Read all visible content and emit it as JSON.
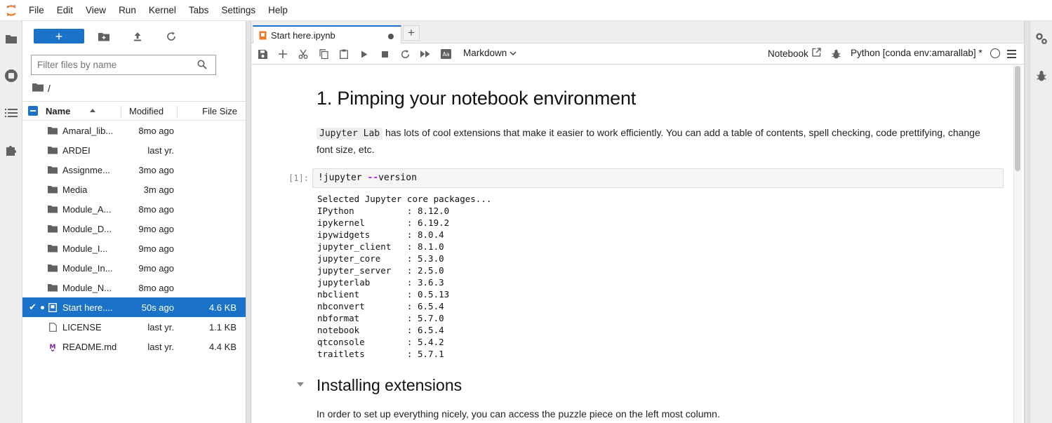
{
  "menubar": {
    "items": [
      "File",
      "Edit",
      "View",
      "Run",
      "Kernel",
      "Tabs",
      "Settings",
      "Help"
    ]
  },
  "filebrowser": {
    "new_label": "+",
    "filter_placeholder": "Filter files by name",
    "breadcrumb": "/",
    "columns": {
      "name": "Name",
      "modified": "Modified",
      "size": "File Size"
    },
    "files": [
      {
        "name": "Amaral_lib...",
        "modified": "8mo ago",
        "size": "",
        "type": "folder"
      },
      {
        "name": "ARDEI",
        "modified": "last yr.",
        "size": "",
        "type": "folder"
      },
      {
        "name": "Assignme...",
        "modified": "3mo ago",
        "size": "",
        "type": "folder"
      },
      {
        "name": "Media",
        "modified": "3m ago",
        "size": "",
        "type": "folder"
      },
      {
        "name": "Module_A...",
        "modified": "8mo ago",
        "size": "",
        "type": "folder"
      },
      {
        "name": "Module_D...",
        "modified": "9mo ago",
        "size": "",
        "type": "folder"
      },
      {
        "name": "Module_I...",
        "modified": "9mo ago",
        "size": "",
        "type": "folder"
      },
      {
        "name": "Module_In...",
        "modified": "9mo ago",
        "size": "",
        "type": "folder"
      },
      {
        "name": "Module_N...",
        "modified": "8mo ago",
        "size": "",
        "type": "folder"
      },
      {
        "name": "Start here....",
        "modified": "50s ago",
        "size": "4.6 KB",
        "type": "notebook",
        "selected": true
      },
      {
        "name": "LICENSE",
        "modified": "last yr.",
        "size": "1.1 KB",
        "type": "file"
      },
      {
        "name": "README.md",
        "modified": "last yr.",
        "size": "4.4 KB",
        "type": "markdown"
      }
    ]
  },
  "tabs": [
    {
      "label": "Start here.ipynb",
      "active": true,
      "unsaved": true
    }
  ],
  "notebook_toolbar": {
    "cell_type": "Markdown",
    "notebook_link": "Notebook",
    "kernel": "Python [conda env:amarallab] *"
  },
  "notebook": {
    "heading1": "1. Pimping your notebook environment",
    "para1_code": "Jupyter Lab",
    "para1_text": " has lots of cool extensions that make it easier to work efficiently. You can add a table of contents, spell checking, code prettifying, change font size, etc.",
    "cell_prompt": "[1]:",
    "cell_code_prefix": "!jupyter ",
    "cell_code_op": "--",
    "cell_code_suffix": "version",
    "output_lines": [
      "Selected Jupyter core packages...",
      "IPython          : 8.12.0",
      "ipykernel        : 6.19.2",
      "ipywidgets       : 8.0.4",
      "jupyter_client   : 8.1.0",
      "jupyter_core     : 5.3.0",
      "jupyter_server   : 2.5.0",
      "jupyterlab       : 3.6.3",
      "nbclient         : 0.5.13",
      "nbconvert        : 6.5.4",
      "nbformat         : 5.7.0",
      "notebook         : 6.5.4",
      "qtconsole        : 5.4.2",
      "traitlets        : 5.7.1"
    ],
    "heading2": "Installing extensions",
    "para2": "In order to set up everything nicely, you can access the puzzle piece on the left most column."
  },
  "colors": {
    "accent": "#1a73c9",
    "logo": "#f37726",
    "markdown_icon": "#7b1fa2"
  }
}
